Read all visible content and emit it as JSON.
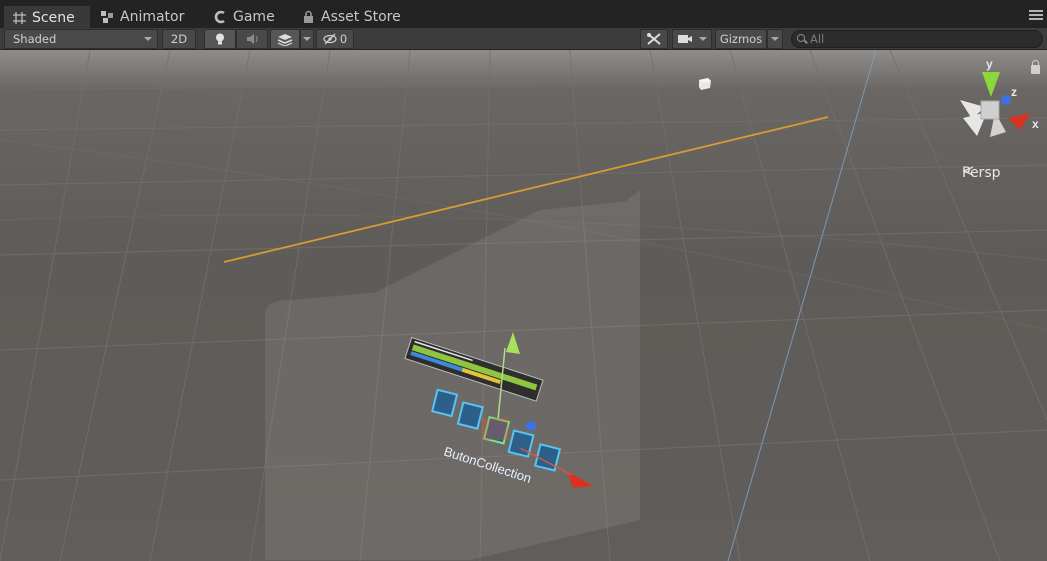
{
  "tabs": [
    {
      "label": "Scene",
      "icon": "grid-icon",
      "active": true
    },
    {
      "label": "Animator",
      "icon": "animator-icon",
      "active": false
    },
    {
      "label": "Game",
      "icon": "game-icon",
      "active": false
    },
    {
      "label": "Asset Store",
      "icon": "lock-icon",
      "active": false
    }
  ],
  "toolbar": {
    "draw_mode": "Shaded",
    "mode_2d": "2D",
    "hidden_count": "0",
    "gizmos_label": "Gizmos",
    "search_placeholder": "All"
  },
  "scene": {
    "view_label": "Persp",
    "object_label": "ButonCollection",
    "axis_labels": {
      "x": "x",
      "y": "y",
      "z": "z"
    },
    "colors": {
      "background": "#5e5a57",
      "orange_line": "#d99a32",
      "axis_x": "#d93320",
      "axis_y": "#8bd83a",
      "axis_z": "#3d73e0",
      "selection": "#55c6ef"
    }
  }
}
